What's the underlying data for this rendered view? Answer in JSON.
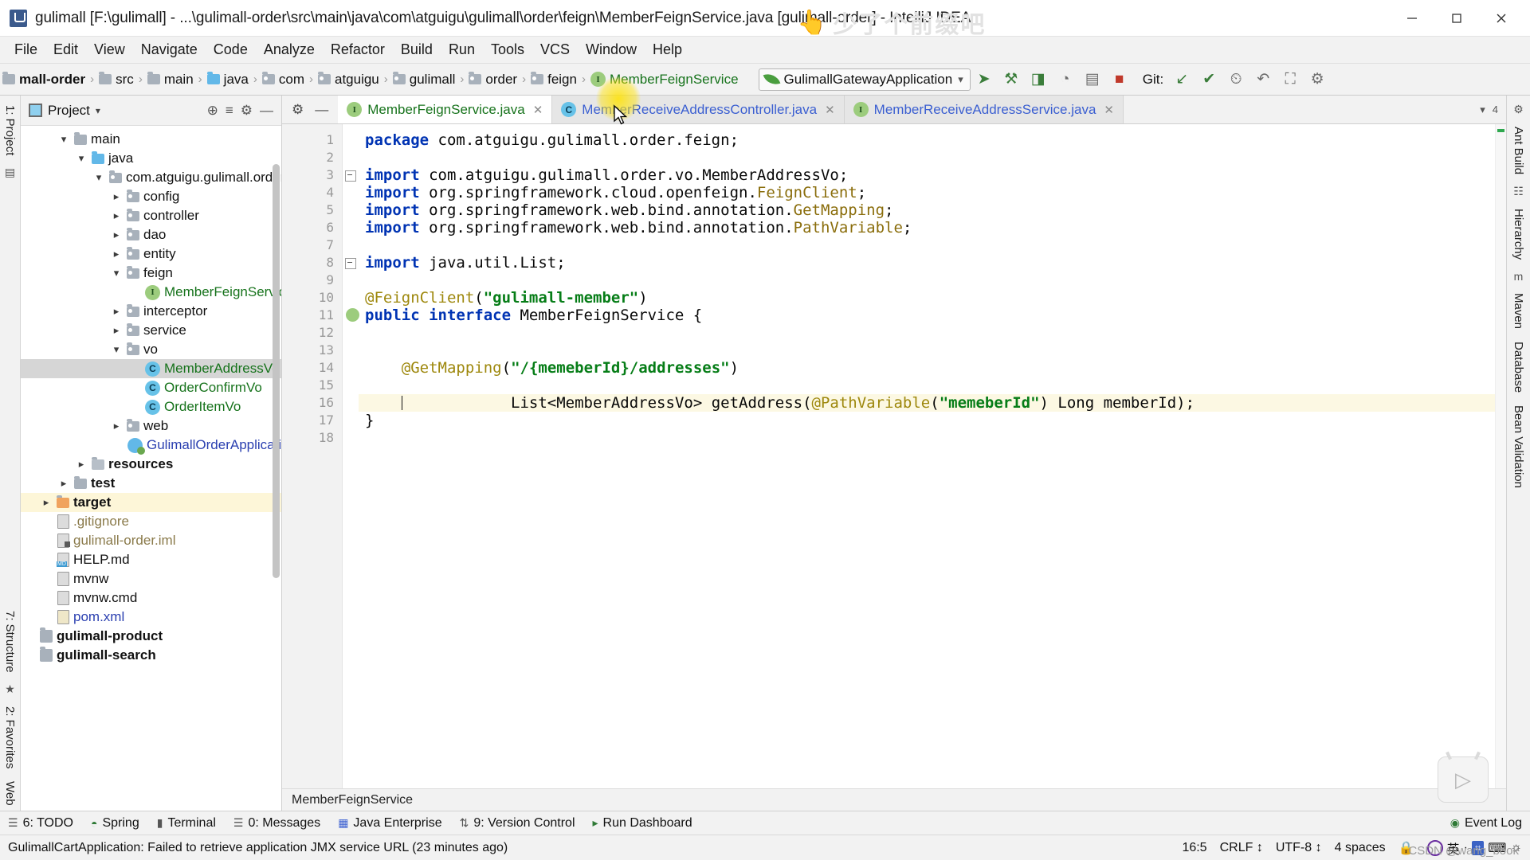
{
  "window": {
    "title": "gulimall [F:\\gulimall] - ...\\gulimall-order\\src\\main\\java\\com\\atguigu\\gulimall\\order\\feign\\MemberFeignService.java [gulimall-order] - IntelliJ IDEA",
    "app_icon": "intellij-idea-icon",
    "minimize_label": "–",
    "maximize_label": "□",
    "close_label": "✕"
  },
  "watermark": {
    "hand_icon": "pointing-hand-icon",
    "text": "少了个前缀吧",
    "csdn": "CSDN @wang_book"
  },
  "menubar": {
    "items": [
      "File",
      "Edit",
      "View",
      "Navigate",
      "Code",
      "Analyze",
      "Refactor",
      "Build",
      "Run",
      "Tools",
      "VCS",
      "Window",
      "Help"
    ]
  },
  "breadcrumb": {
    "items": [
      {
        "label": "mall-order",
        "icon": "module-icon",
        "bold": true
      },
      {
        "label": "src",
        "icon": "folder-icon"
      },
      {
        "label": "main",
        "icon": "folder-icon"
      },
      {
        "label": "java",
        "icon": "source-folder-icon"
      },
      {
        "label": "com",
        "icon": "package-icon"
      },
      {
        "label": "atguigu",
        "icon": "package-icon"
      },
      {
        "label": "gulimall",
        "icon": "package-icon"
      },
      {
        "label": "order",
        "icon": "package-icon"
      },
      {
        "label": "feign",
        "icon": "package-icon"
      },
      {
        "label": "MemberFeignService",
        "icon": "interface-icon",
        "green": true
      }
    ],
    "separator": "›"
  },
  "toolbar": {
    "back_icon": "back-arrow-icon",
    "run_config": {
      "icon": "spring-leaf-icon",
      "label": "GulimallGatewayApplication",
      "caret": "▾"
    },
    "buttons": [
      {
        "name": "run-button",
        "glyph": "➤"
      },
      {
        "name": "debug-button",
        "glyph": "⚒"
      },
      {
        "name": "run-with-coverage-button",
        "glyph": "◨"
      },
      {
        "name": "profile-button",
        "glyph": "◔"
      },
      {
        "name": "run-dashboard-button",
        "glyph": "▤"
      },
      {
        "name": "stop-button",
        "glyph": "■"
      }
    ],
    "git_label": "Git:",
    "git_buttons": [
      {
        "name": "update-project-button",
        "glyph": "↙"
      },
      {
        "name": "commit-button",
        "glyph": "✔"
      },
      {
        "name": "history-button",
        "glyph": "⏲"
      },
      {
        "name": "rollback-button",
        "glyph": "↶"
      },
      {
        "name": "search-everywhere-button",
        "glyph": "⛶"
      },
      {
        "name": "settings-button",
        "glyph": "⚙"
      }
    ]
  },
  "project_panel": {
    "title": "Project",
    "icon": "project-view-icon",
    "caret": "▾",
    "actions": [
      {
        "name": "select-opened-file-icon",
        "glyph": "⊕"
      },
      {
        "name": "collapse-all-icon",
        "glyph": "≡"
      },
      {
        "name": "settings-gear-icon",
        "glyph": "⚙"
      },
      {
        "name": "hide-panel-icon",
        "glyph": "—"
      }
    ],
    "tree": [
      {
        "label": "main",
        "icon": "folder-icon",
        "indent": 2,
        "state": "open",
        "color": "black"
      },
      {
        "label": "java",
        "icon": "source-folder-icon",
        "indent": 3,
        "state": "open",
        "color": "black"
      },
      {
        "label": "com.atguigu.gulimall.order",
        "icon": "package-icon",
        "indent": 4,
        "state": "open",
        "color": "black"
      },
      {
        "label": "config",
        "icon": "package-icon",
        "indent": 5,
        "state": "closed",
        "color": "black"
      },
      {
        "label": "controller",
        "icon": "package-icon",
        "indent": 5,
        "state": "closed",
        "color": "black"
      },
      {
        "label": "dao",
        "icon": "package-icon",
        "indent": 5,
        "state": "closed",
        "color": "black"
      },
      {
        "label": "entity",
        "icon": "package-icon",
        "indent": 5,
        "state": "closed",
        "color": "black"
      },
      {
        "label": "feign",
        "icon": "package-icon",
        "indent": 5,
        "state": "open",
        "color": "black"
      },
      {
        "label": "MemberFeignService",
        "icon": "interface-icon",
        "indent": 7,
        "state": "none",
        "color": "green"
      },
      {
        "label": "interceptor",
        "icon": "package-icon",
        "indent": 5,
        "state": "closed",
        "color": "black"
      },
      {
        "label": "service",
        "icon": "package-icon",
        "indent": 5,
        "state": "closed",
        "color": "black"
      },
      {
        "label": "vo",
        "icon": "package-icon",
        "indent": 5,
        "state": "open",
        "color": "black"
      },
      {
        "label": "MemberAddressVo",
        "icon": "class-icon",
        "indent": 7,
        "state": "none",
        "color": "green",
        "selected": true
      },
      {
        "label": "OrderConfirmVo",
        "icon": "class-icon",
        "indent": 7,
        "state": "none",
        "color": "green"
      },
      {
        "label": "OrderItemVo",
        "icon": "class-icon",
        "indent": 7,
        "state": "none",
        "color": "green"
      },
      {
        "label": "web",
        "icon": "package-icon",
        "indent": 5,
        "state": "closed",
        "color": "black"
      },
      {
        "label": "GulimallOrderApplication",
        "icon": "spring-boot-class-icon",
        "indent": 6,
        "state": "none",
        "color": "blue"
      },
      {
        "label": "resources",
        "icon": "resources-folder-icon",
        "indent": 3,
        "state": "closed",
        "color": "black"
      },
      {
        "label": "test",
        "icon": "test-folder-icon",
        "indent": 2,
        "state": "closed",
        "color": "black"
      },
      {
        "label": "target",
        "icon": "target-folder-icon",
        "indent": 1,
        "state": "closed",
        "color": "black",
        "highlight": true
      },
      {
        "label": ".gitignore",
        "icon": "file-icon",
        "indent": 2,
        "state": "none",
        "color": "tan"
      },
      {
        "label": "gulimall-order.iml",
        "icon": "iml-file-icon",
        "indent": 2,
        "state": "none",
        "color": "tan"
      },
      {
        "label": "HELP.md",
        "icon": "markdown-file-icon",
        "indent": 2,
        "state": "none",
        "color": "black"
      },
      {
        "label": "mvnw",
        "icon": "file-icon",
        "indent": 2,
        "state": "none",
        "color": "black"
      },
      {
        "label": "mvnw.cmd",
        "icon": "file-icon",
        "indent": 2,
        "state": "none",
        "color": "black"
      },
      {
        "label": "pom.xml",
        "icon": "maven-file-icon",
        "indent": 2,
        "state": "none",
        "color": "blue"
      },
      {
        "label": "gulimall-product",
        "icon": "module-folder-icon",
        "indent": 0,
        "state": "none",
        "color": "black",
        "bold": true
      },
      {
        "label": "gulimall-search",
        "icon": "module-folder-icon",
        "indent": 0,
        "state": "none",
        "color": "black",
        "bold": true
      }
    ]
  },
  "left_rail": {
    "items": [
      "1: Project",
      "7: Structure",
      "2: Favorites",
      "Web"
    ]
  },
  "right_rail": {
    "items": [
      "Ant Build",
      "Hierarchy",
      "Maven",
      "Database",
      "Bean Validation",
      "Event Log"
    ]
  },
  "editor": {
    "tools": [
      {
        "name": "settings-gear-icon",
        "glyph": "⚙"
      },
      {
        "name": "hide-editor-icon",
        "glyph": "—"
      }
    ],
    "tabs": [
      {
        "label": "MemberFeignService.java",
        "icon": "interface-icon",
        "active": true,
        "color": "green"
      },
      {
        "label": "MemberReceiveAddressController.java",
        "icon": "class-icon",
        "active": false,
        "color": "blue"
      },
      {
        "label": "MemberReceiveAddressService.java",
        "icon": "interface-icon",
        "active": false,
        "color": "green"
      }
    ],
    "tab_close": "✕",
    "tab_overflow": "▾",
    "tab_count": "4",
    "bottom_breadcrumb": "MemberFeignService",
    "lines": [
      {
        "n": 1,
        "tokens": [
          {
            "t": "package ",
            "c": "kw"
          },
          {
            "t": "com.atguigu.gulimall.order.feign;",
            "c": "plain"
          }
        ]
      },
      {
        "n": 2,
        "tokens": []
      },
      {
        "n": 3,
        "fold": true,
        "tokens": [
          {
            "t": "import ",
            "c": "kw"
          },
          {
            "t": "com.atguigu.gulimall.order.vo.MemberAddressVo;",
            "c": "plain"
          }
        ]
      },
      {
        "n": 4,
        "tokens": [
          {
            "t": "import ",
            "c": "kw"
          },
          {
            "t": "org.springframework.cloud.openfeign.",
            "c": "plain"
          },
          {
            "t": "FeignClient",
            "c": "typ"
          },
          {
            "t": ";",
            "c": "plain"
          }
        ]
      },
      {
        "n": 5,
        "tokens": [
          {
            "t": "import ",
            "c": "kw"
          },
          {
            "t": "org.springframework.web.bind.annotation.",
            "c": "plain"
          },
          {
            "t": "GetMapping",
            "c": "typ"
          },
          {
            "t": ";",
            "c": "plain"
          }
        ]
      },
      {
        "n": 6,
        "tokens": [
          {
            "t": "import ",
            "c": "kw"
          },
          {
            "t": "org.springframework.web.bind.annotation.",
            "c": "plain"
          },
          {
            "t": "PathVariable",
            "c": "typ"
          },
          {
            "t": ";",
            "c": "plain"
          }
        ]
      },
      {
        "n": 7,
        "tokens": []
      },
      {
        "n": 8,
        "fold": true,
        "tokens": [
          {
            "t": "import ",
            "c": "kw"
          },
          {
            "t": "java.util.List;",
            "c": "plain"
          }
        ]
      },
      {
        "n": 9,
        "tokens": []
      },
      {
        "n": 10,
        "tokens": [
          {
            "t": "@FeignClient",
            "c": "ann"
          },
          {
            "t": "(",
            "c": "plain"
          },
          {
            "t": "\"gulimall-member\"",
            "c": "str"
          },
          {
            "t": ")",
            "c": "plain"
          }
        ]
      },
      {
        "n": 11,
        "gutter_icon": "interface-marker-icon",
        "tokens": [
          {
            "t": "public ",
            "c": "kw"
          },
          {
            "t": "interface ",
            "c": "kw"
          },
          {
            "t": "MemberFeignService {",
            "c": "plain"
          }
        ]
      },
      {
        "n": 12,
        "tokens": []
      },
      {
        "n": 13,
        "tokens": []
      },
      {
        "n": 14,
        "tokens": [
          {
            "t": "    ",
            "c": "plain"
          },
          {
            "t": "@GetMapping",
            "c": "ann"
          },
          {
            "t": "(",
            "c": "plain"
          },
          {
            "t": "\"/{memeberId}/addresses\"",
            "c": "str"
          },
          {
            "t": ")",
            "c": "plain"
          }
        ]
      },
      {
        "n": 15,
        "bulb": true,
        "tokens": [
          {
            "t": "    List<MemberAddressVo> getAddress(",
            "c": "plain"
          },
          {
            "t": "@PathVariable",
            "c": "ann"
          },
          {
            "t": "(",
            "c": "plain"
          },
          {
            "t": "\"memeberId\"",
            "c": "str"
          },
          {
            "t": ") Long memberId);",
            "c": "plain"
          }
        ]
      },
      {
        "n": 16,
        "current": true,
        "caret": true,
        "tokens": [
          {
            "t": "    ",
            "c": "plain"
          }
        ]
      },
      {
        "n": 17,
        "tokens": [
          {
            "t": "}",
            "c": "plain"
          }
        ]
      },
      {
        "n": 18,
        "tokens": []
      }
    ]
  },
  "toolstrip": {
    "items": [
      {
        "label": "6: TODO",
        "icon": "todo-icon"
      },
      {
        "label": "Spring",
        "icon": "spring-icon"
      },
      {
        "label": "Terminal",
        "icon": "terminal-icon"
      },
      {
        "label": "0: Messages",
        "icon": "messages-icon"
      },
      {
        "label": "Java Enterprise",
        "icon": "java-enterprise-icon"
      },
      {
        "label": "9: Version Control",
        "icon": "version-control-icon"
      },
      {
        "label": "Run Dashboard",
        "icon": "run-dashboard-icon"
      }
    ],
    "event_log": {
      "label": "Event Log",
      "icon": "event-log-icon"
    }
  },
  "statusbar": {
    "message": "GulimallCartApplication: Failed to retrieve application JMX service URL (23 minutes ago)",
    "caret_position": "16:5",
    "line_separator": "CRLF",
    "line_separator_caret": "↕",
    "encoding": "UTF-8",
    "encoding_caret": "↕",
    "indent": "4 spaces",
    "ime_lang": "英",
    "ime_items": [
      "·",
      "⌗",
      "⌨",
      "☼"
    ],
    "lock_icon": "lock-icon"
  },
  "colors": {
    "keyword": "#0033b3",
    "string": "#067d17",
    "annotation": "#9e880d",
    "type": "#8a6d0b",
    "green_identifier": "#17731c",
    "blue_identifier": "#3b5fd1",
    "current_line": "#fcf8e3",
    "selection": "#d6d6d6",
    "highlight_row": "#fdf6d8"
  }
}
